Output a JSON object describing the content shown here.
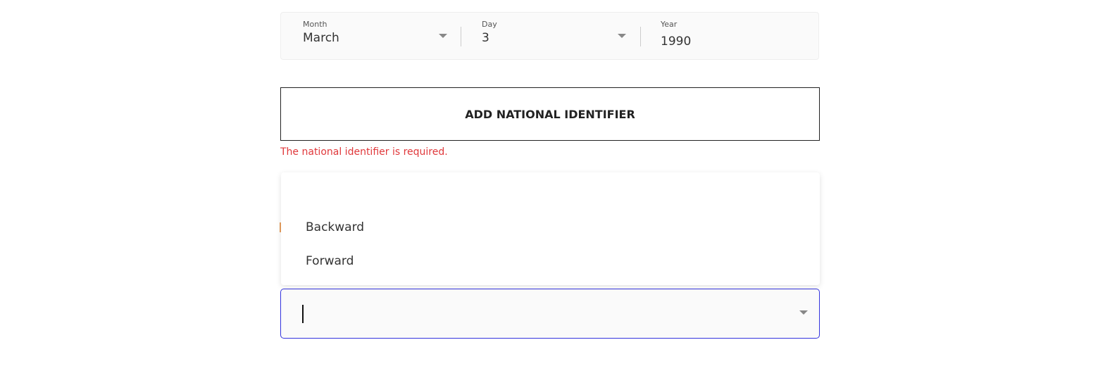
{
  "dob": {
    "month": {
      "label": "Month",
      "value": "March"
    },
    "day": {
      "label": "Day",
      "value": "3"
    },
    "year": {
      "label": "Year",
      "value": "1990"
    }
  },
  "add_national_identifier_label": "ADD NATIONAL IDENTIFIER",
  "error_message": "The national identifier is required.",
  "dropdown": {
    "options": [
      "Backward",
      "Forward"
    ],
    "input_value": ""
  },
  "colors": {
    "error": "#e0383b",
    "focus": "#3333dd"
  }
}
